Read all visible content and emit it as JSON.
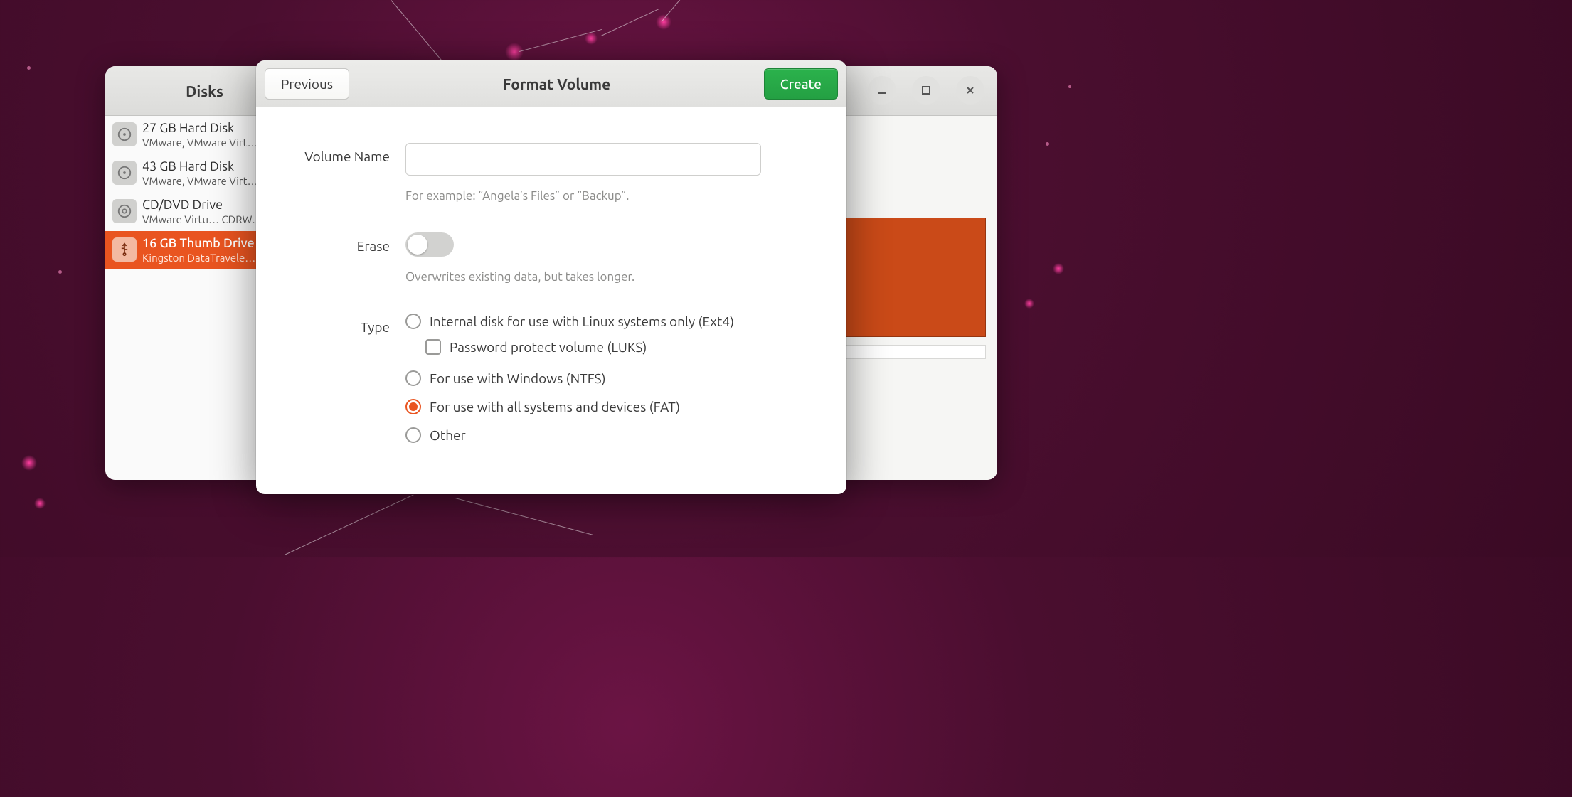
{
  "main": {
    "title": "Disks"
  },
  "sidebar": {
    "items": [
      {
        "title": "27 GB Hard Disk",
        "sub": "VMware, VMware Virt…",
        "icon": "hdd"
      },
      {
        "title": "43 GB Hard Disk",
        "sub": "VMware, VMware Virt…",
        "icon": "hdd"
      },
      {
        "title": "CD/DVD Drive",
        "sub": "VMware Virtu… CDRW…",
        "icon": "optical"
      },
      {
        "title": "16 GB Thumb Drive",
        "sub": "Kingston DataTravele…",
        "icon": "usb",
        "selected": true
      }
    ]
  },
  "dialog": {
    "title": "Format Volume",
    "previous_label": "Previous",
    "create_label": "Create",
    "volume_name_label": "Volume Name",
    "volume_name_value": "",
    "volume_name_hint": "For example: “Angela’s Files” or “Backup”.",
    "erase_label": "Erase",
    "erase_value": false,
    "erase_hint": "Overwrites existing data, but takes longer.",
    "type_label": "Type",
    "type_options": {
      "ext4": "Internal disk for use with Linux systems only (Ext4)",
      "luks": "Password protect volume (LUKS)",
      "ntfs": "For use with Windows (NTFS)",
      "fat": "For use with all systems and devices (FAT)",
      "other": "Other"
    },
    "type_selected": "fat",
    "luks_checked": false
  },
  "window_controls": {
    "menu": "menu",
    "minimize": "minimize",
    "maximize": "maximize",
    "close": "close"
  }
}
